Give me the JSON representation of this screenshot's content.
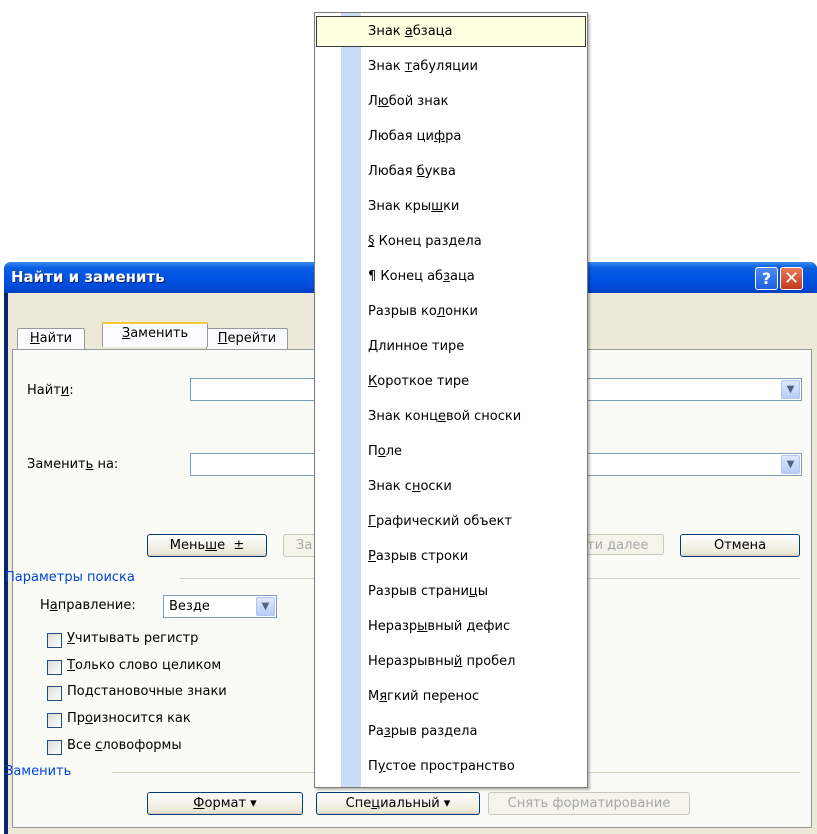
{
  "dialog": {
    "title": "Найти и заменить",
    "help_icon": "?",
    "close_icon": "✕"
  },
  "tabs": [
    {
      "pre": "",
      "key": "Н",
      "post": "айти"
    },
    {
      "pre": "",
      "key": "З",
      "post": "аменить"
    },
    {
      "pre": "",
      "key": "П",
      "post": "ерейти"
    }
  ],
  "find": {
    "pre": "Найт",
    "key": "и",
    "post": ":",
    "value": ""
  },
  "replace": {
    "pre": "Заменит",
    "key": "ь",
    "post": " на:",
    "value": ""
  },
  "buttons": {
    "less_pre": "Мень",
    "less_key": "ш",
    "less_post": "е",
    "less_arrow": "±",
    "replace_partial": "За",
    "find_next_partial": "ти далее",
    "cancel": "Отмена",
    "format_key": "Ф",
    "format_post": "ормат ▾",
    "special_pre": "Спе",
    "special_key": "ц",
    "special_post": "иальный ▾",
    "clear_format": "Снять форматирование"
  },
  "search_options": {
    "group_label": "Параметры поиска",
    "direction_pre": "Н",
    "direction_key": "а",
    "direction_post": "правление:",
    "direction_value": "Везде",
    "checkboxes": [
      {
        "pre": "",
        "key": "У",
        "post": "читывать регистр"
      },
      {
        "pre": "",
        "key": "Т",
        "post": "олько слово целиком"
      },
      {
        "pre": "По",
        "key": "д",
        "post": "становочные знаки"
      },
      {
        "pre": "Пр",
        "key": "о",
        "post": "износится как"
      },
      {
        "pre": "Все ",
        "key": "с",
        "post": "ловоформы"
      }
    ]
  },
  "replace_group_label": "Заменить",
  "menu": {
    "items": [
      {
        "pre": "Знак ",
        "key": "а",
        "post": "бзаца"
      },
      {
        "pre": "Знак ",
        "key": "т",
        "post": "абуляции"
      },
      {
        "pre": "Л",
        "key": "ю",
        "post": "бой знак"
      },
      {
        "pre": "Любая ци",
        "key": "ф",
        "post": "ра"
      },
      {
        "pre": "Любая ",
        "key": "б",
        "post": "уква"
      },
      {
        "pre": "Знак кры",
        "key": "ш",
        "post": "ки"
      },
      {
        "pre": "",
        "key": "§",
        "post": " Конец раздела"
      },
      {
        "pre": "¶ Конец аб",
        "key": "з",
        "post": "аца"
      },
      {
        "pre": "Разрыв ко",
        "key": "л",
        "post": "онки"
      },
      {
        "pre": "",
        "key": "Д",
        "post": "линное тире"
      },
      {
        "pre": "",
        "key": "К",
        "post": "ороткое тире"
      },
      {
        "pre": "Знак конц",
        "key": "е",
        "post": "вой сноски"
      },
      {
        "pre": "П",
        "key": "о",
        "post": "ле"
      },
      {
        "pre": "Знак с",
        "key": "н",
        "post": "оски"
      },
      {
        "pre": "",
        "key": "Г",
        "post": "рафический объект"
      },
      {
        "pre": "",
        "key": "Р",
        "post": "азрыв строки"
      },
      {
        "pre": "Разрыв страни",
        "key": "ц",
        "post": "ы"
      },
      {
        "pre": "Неразр",
        "key": "ы",
        "post": "вный дефис"
      },
      {
        "pre": "Неразрывны",
        "key": "й",
        "post": " пробел"
      },
      {
        "pre": "М",
        "key": "я",
        "post": "гкий перенос"
      },
      {
        "pre": "Ра",
        "key": "з",
        "post": "рыв раздела"
      },
      {
        "pre": "П",
        "key": "у",
        "post": "стое пространство"
      }
    ]
  },
  "colors": {
    "titlebar": "#0054e3",
    "group_label": "#0046d5",
    "menu_highlight": "#ffffe1",
    "menu_strip": "#c8dcf6"
  }
}
